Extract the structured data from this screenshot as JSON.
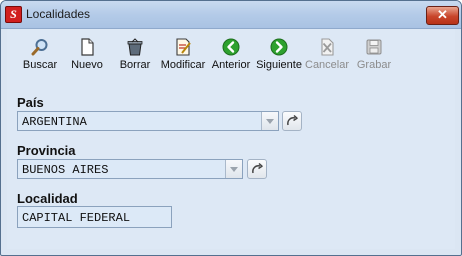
{
  "window": {
    "title": "Localidades",
    "close_label": "✕"
  },
  "toolbar": {
    "buttons": [
      {
        "label": "Buscar",
        "icon": "search-icon",
        "enabled": true
      },
      {
        "label": "Nuevo",
        "icon": "new-document-icon",
        "enabled": true
      },
      {
        "label": "Borrar",
        "icon": "trash-icon",
        "enabled": true
      },
      {
        "label": "Modificar",
        "icon": "edit-icon",
        "enabled": true
      },
      {
        "label": "Anterior",
        "icon": "arrow-left-icon",
        "enabled": true
      },
      {
        "label": "Siguiente",
        "icon": "arrow-right-icon",
        "enabled": true
      },
      {
        "label": "Cancelar",
        "icon": "cancel-icon",
        "enabled": false
      },
      {
        "label": "Grabar",
        "icon": "save-icon",
        "enabled": false
      }
    ]
  },
  "form": {
    "pais": {
      "label": "País",
      "value": "ARGENTINA"
    },
    "provincia": {
      "label": "Provincia",
      "value": "BUENOS AIRES"
    },
    "localidad": {
      "label": "Localidad",
      "value": "CAPITAL FEDERAL"
    }
  },
  "colors": {
    "accent_green": "#2ea12e",
    "close_red": "#c8452b",
    "field_bg": "#dce9f7"
  }
}
